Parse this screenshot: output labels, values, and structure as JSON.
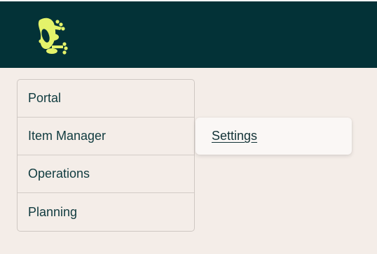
{
  "header": {
    "logo_icon": "frog-logo-icon",
    "background_color": "#033237",
    "logo_color": "#e4f36a"
  },
  "menu": {
    "items": [
      {
        "label": "Portal"
      },
      {
        "label": "Item Manager"
      },
      {
        "label": "Operations"
      },
      {
        "label": "Planning"
      }
    ]
  },
  "submenu": {
    "items": [
      {
        "label": "Settings"
      }
    ]
  }
}
